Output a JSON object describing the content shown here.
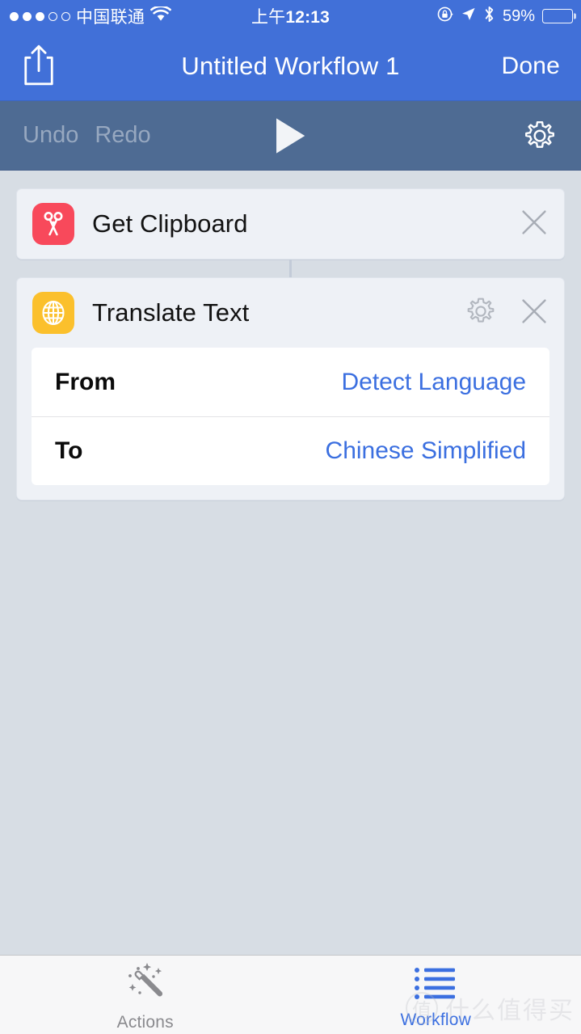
{
  "status_bar": {
    "signal_dots_filled": 3,
    "signal_dots_total": 5,
    "carrier": "中国联通",
    "wifi_icon": "wifi-icon",
    "time": "上午12:13",
    "time_prefix": "上午",
    "time_value": "12:13",
    "rotation_lock_icon": "rotation-lock-icon",
    "location_icon": "location-arrow-icon",
    "bluetooth_icon": "bluetooth-icon",
    "battery_percent": "59%",
    "battery_level": 59
  },
  "nav_bar": {
    "share_icon": "share-icon",
    "title": "Untitled Workflow 1",
    "done_label": "Done"
  },
  "toolbar": {
    "undo_label": "Undo",
    "redo_label": "Redo",
    "play_icon": "play-icon",
    "settings_icon": "gear-icon"
  },
  "workflow": {
    "actions": [
      {
        "icon": "scissors-icon",
        "icon_color": "#f8495b",
        "title": "Get Clipboard",
        "has_settings": false,
        "close_icon": "close-icon",
        "params": []
      },
      {
        "icon": "globe-icon",
        "icon_color": "#fbc02c",
        "title": "Translate Text",
        "has_settings": true,
        "settings_icon": "gear-icon",
        "close_icon": "close-icon",
        "params": [
          {
            "label": "From",
            "value": "Detect Language"
          },
          {
            "label": "To",
            "value": "Chinese Simplified"
          }
        ]
      }
    ]
  },
  "tab_bar": {
    "tabs": [
      {
        "label": "Actions",
        "icon": "magic-wand-icon",
        "active": false
      },
      {
        "label": "Workflow",
        "icon": "list-icon",
        "active": true
      }
    ]
  },
  "watermark": {
    "badge": "值",
    "text": "什么值得买"
  },
  "colors": {
    "nav_blue": "#4170d8",
    "toolbar_blue_gray": "#4e6b93",
    "canvas": "#d7dde4",
    "card": "#eef1f6",
    "accent_blue": "#3b6fe0",
    "scissors_red": "#f8495b",
    "globe_yellow": "#fbc02c"
  }
}
